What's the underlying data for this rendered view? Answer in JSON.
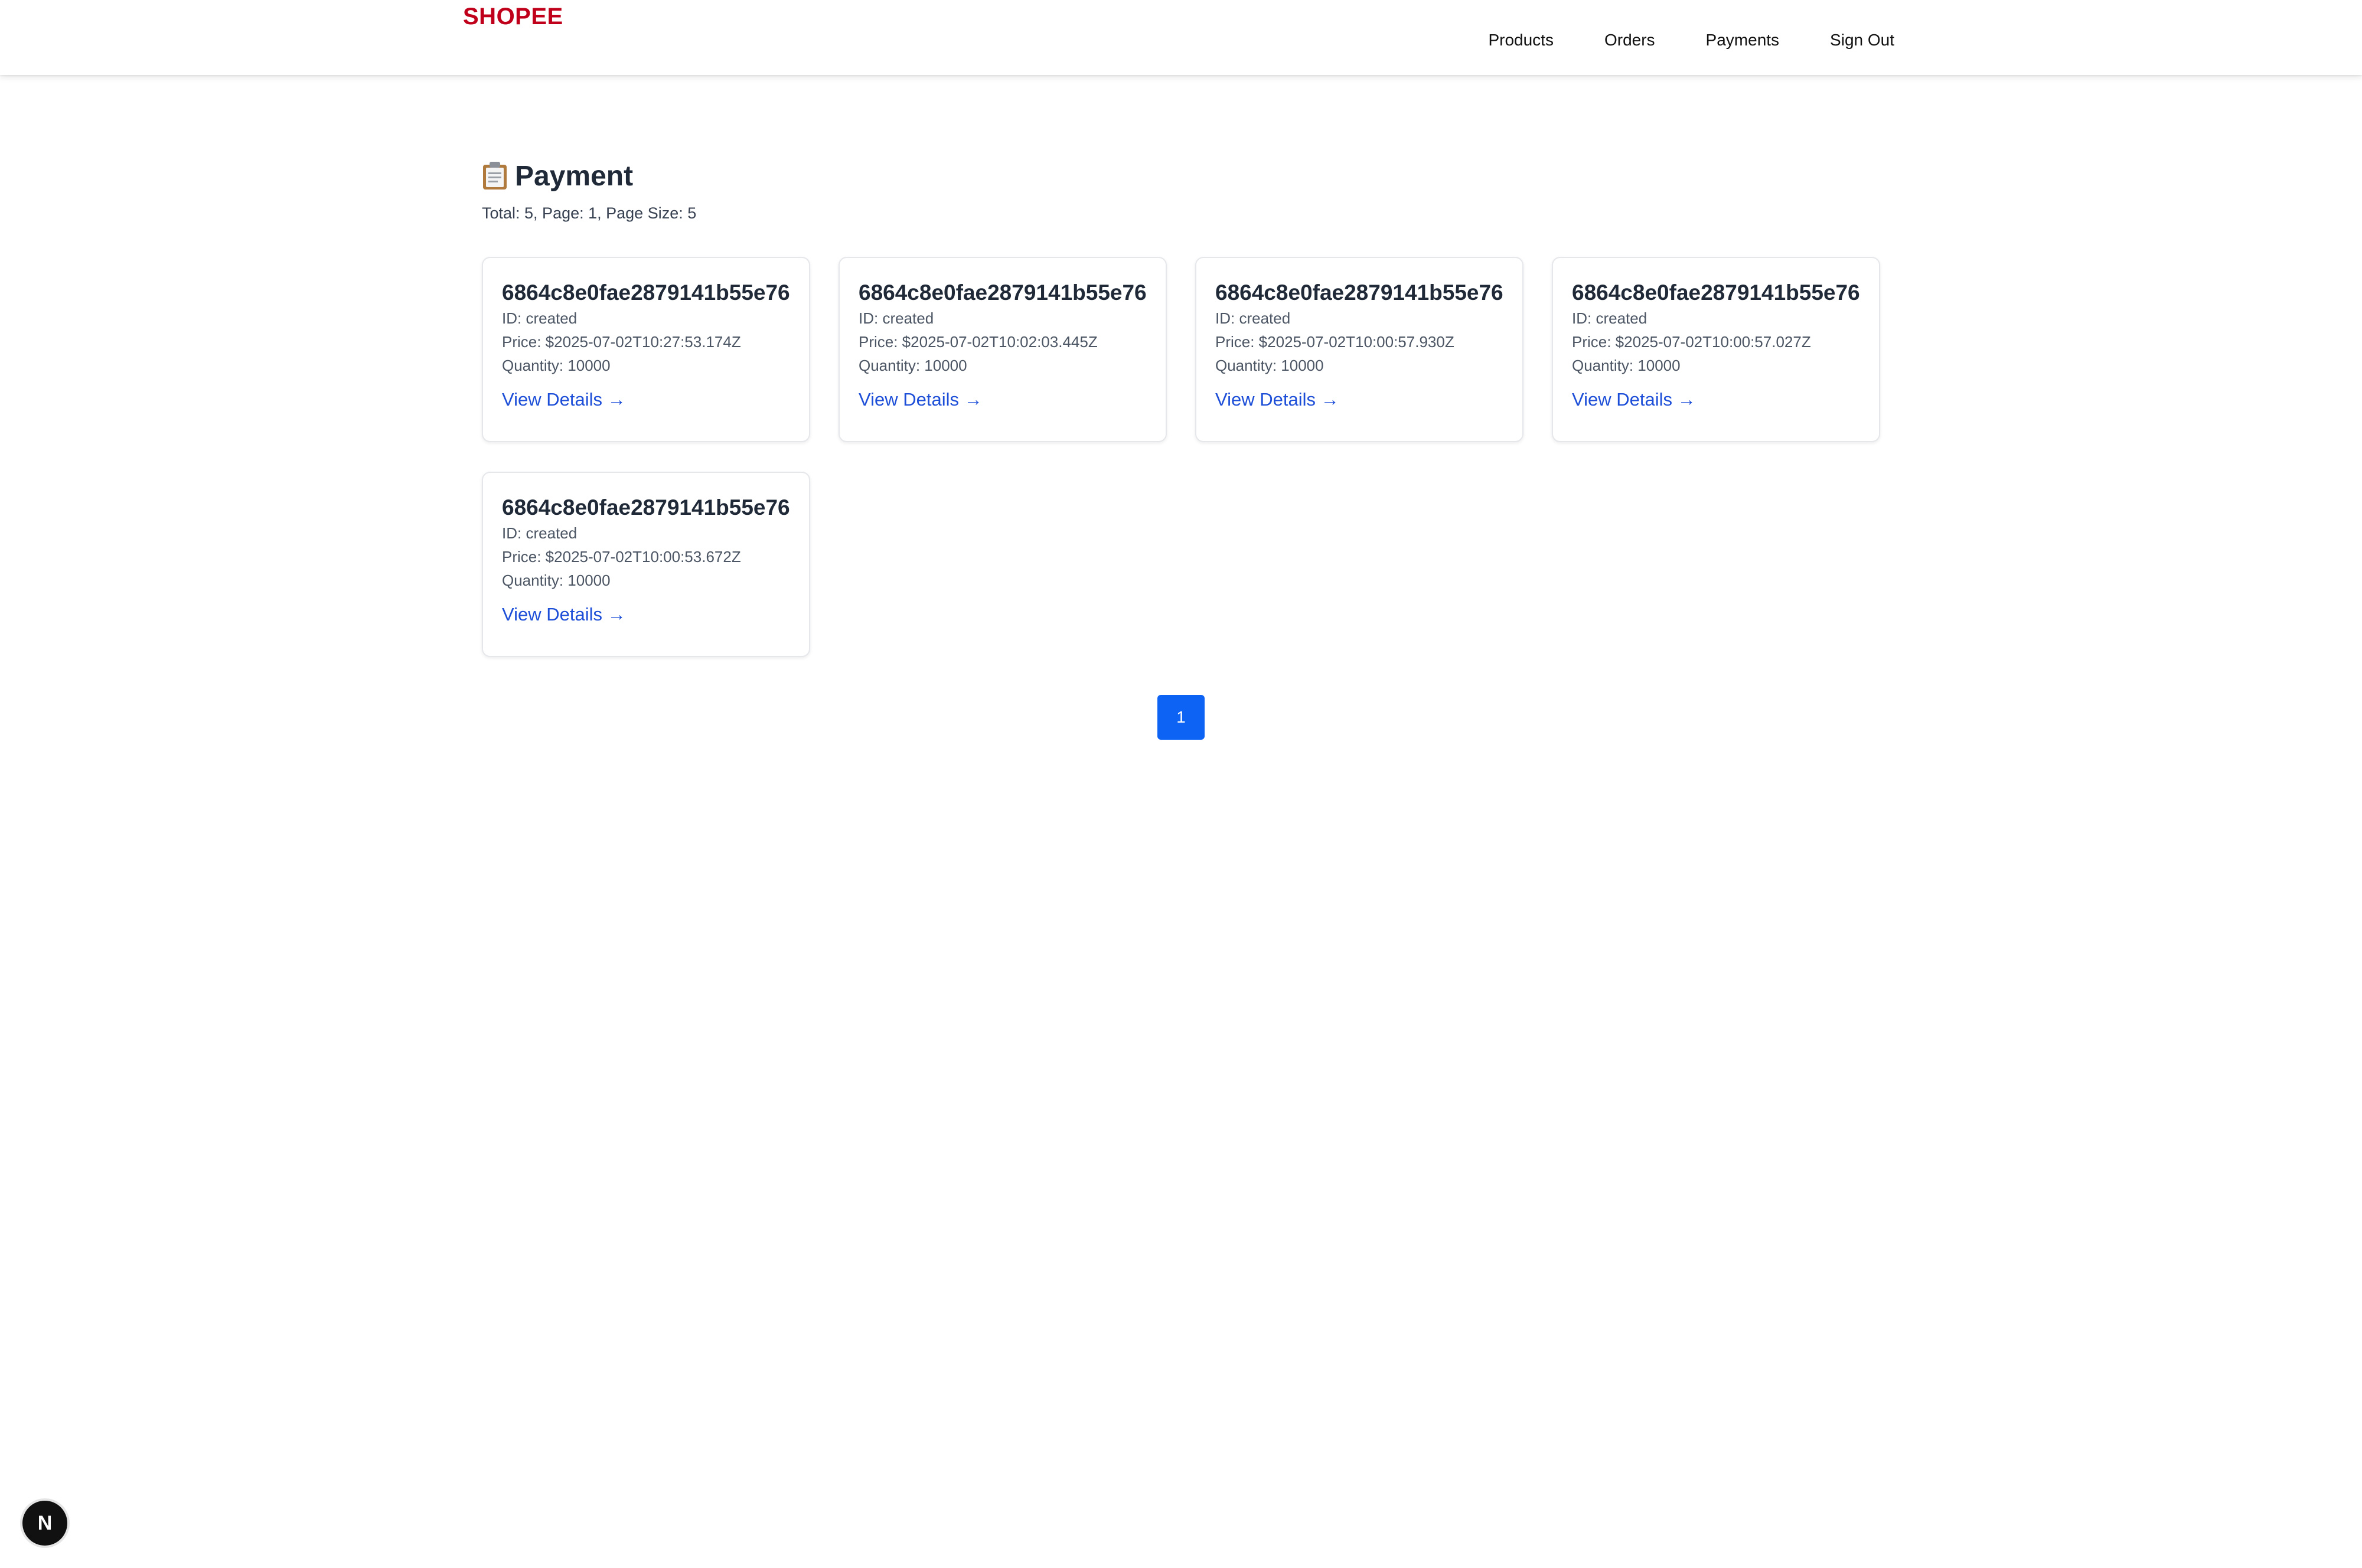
{
  "header": {
    "brand": "SHOPEE",
    "nav": [
      {
        "label": "Products"
      },
      {
        "label": "Orders"
      },
      {
        "label": "Payments"
      },
      {
        "label": "Sign Out"
      }
    ]
  },
  "page": {
    "icon": "clipboard-icon",
    "title": "Payment",
    "summary": "Total: 5, Page: 1, Page Size: 5"
  },
  "payments": [
    {
      "title": "6864c8e0fae2879141b55e76",
      "id_line": "ID: created",
      "price_line": "Price: $2025-07-02T10:27:53.174Z",
      "quantity_line": "Quantity: 10000",
      "link": "View Details →"
    },
    {
      "title": "6864c8e0fae2879141b55e76",
      "id_line": "ID: created",
      "price_line": "Price: $2025-07-02T10:02:03.445Z",
      "quantity_line": "Quantity: 10000",
      "link": "View Details →"
    },
    {
      "title": "6864c8e0fae2879141b55e76",
      "id_line": "ID: created",
      "price_line": "Price: $2025-07-02T10:00:57.930Z",
      "quantity_line": "Quantity: 10000",
      "link": "View Details →"
    },
    {
      "title": "6864c8e0fae2879141b55e76",
      "id_line": "ID: created",
      "price_line": "Price: $2025-07-02T10:00:57.027Z",
      "quantity_line": "Quantity: 10000",
      "link": "View Details →"
    },
    {
      "title": "6864c8e0fae2879141b55e76",
      "id_line": "ID: created",
      "price_line": "Price: $2025-07-02T10:00:53.672Z",
      "quantity_line": "Quantity: 10000",
      "link": "View Details →"
    }
  ],
  "pagination": {
    "current_page": "1"
  },
  "dev_badge": {
    "letter": "N",
    "icon": "nextjs-icon"
  },
  "colors": {
    "brand": "#c0001a",
    "link": "#1d4ed8",
    "pager_active": "#0d63f3"
  }
}
